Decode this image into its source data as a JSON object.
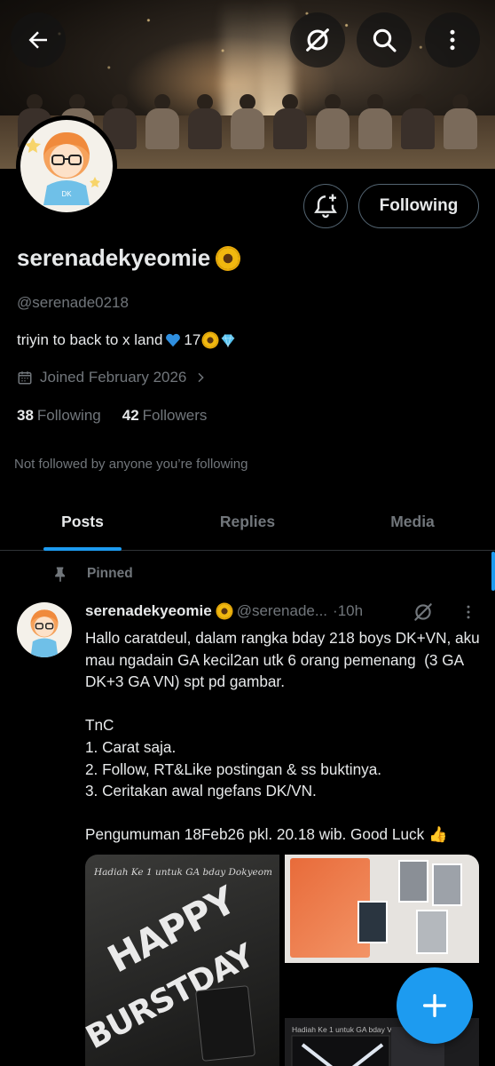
{
  "header": {
    "back_icon": "arrow-left-icon",
    "grok_icon": "grok-icon",
    "search_icon": "search-icon",
    "more_icon": "more-vertical-icon"
  },
  "profile": {
    "display_name": "serenadekyeomie",
    "name_emoji": "sunflower",
    "handle": "@serenade0218",
    "bio": "triyin to back to x land",
    "bio_number": "17",
    "bio_emojis": [
      "blue-heart",
      "sunflower",
      "gem"
    ],
    "joined": "Joined February 2026",
    "following_count": "38",
    "following_label": "Following",
    "followers_count": "42",
    "followers_label": "Followers",
    "not_followed_text": "Not followed by anyone you’re following",
    "follow_button": "Following",
    "avatar_badge": "DK"
  },
  "tabs": [
    {
      "label": "Posts",
      "active": true
    },
    {
      "label": "Replies",
      "active": false
    },
    {
      "label": "Media",
      "active": false
    }
  ],
  "post": {
    "pinned_label": "Pinned",
    "author": "serenadekyeomie",
    "handle": "@serenade...",
    "time": "·10h",
    "body": "Hallo caratdeul, dalam rangka bday 218 boys DK+VN, aku mau ngadain GA kecil2an utk 6 orang pemenang  (3 GA DK+3 GA VN) spt pd gambar.\n\nTnC\n1. Carat saja.\n2. Follow, RT&Like postingan & ss buktinya.\n3. Ceritakan awal ngefans DK/VN.\n\nPengumuman 18Feb26 pkl. 20.18 wib. Good Luck 👍",
    "media": {
      "image1_caption": "Hadiah Ke 1 untuk GA bday Dokyeom",
      "image1_title_line1": "HAPPY",
      "image1_title_line2": "BURSTDAY",
      "image3_caption": "Hadiah Ke 1 untuk GA bday Vernon"
    }
  },
  "fab": {
    "icon": "plus-icon"
  },
  "colors": {
    "accent": "#1d9bf0",
    "background": "#000000",
    "text": "#e7e9ea",
    "muted": "#71767b"
  }
}
